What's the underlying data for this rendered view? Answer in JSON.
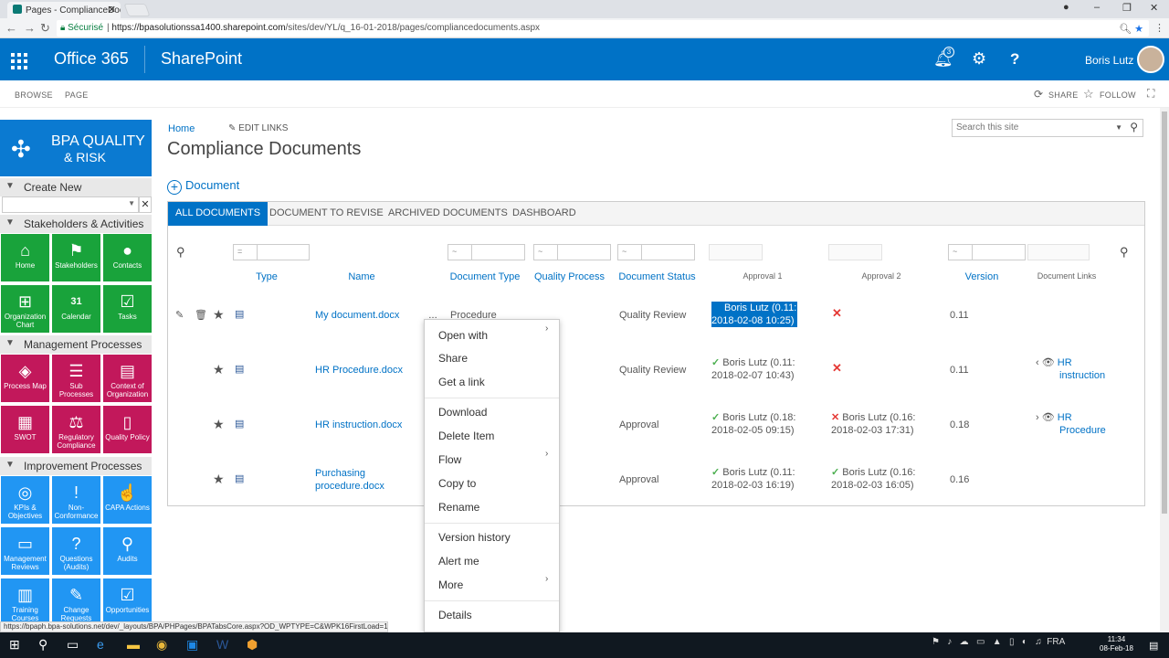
{
  "browser": {
    "tab_title": "Pages - ComplianceDocu",
    "security": "Sécurisé",
    "url_domain": "https://bpasolutionssa1400.sharepoint.com",
    "url_path": "/sites/dev/YL/q_16-01-2018/pages/compliancedocuments.aspx"
  },
  "suite": {
    "product": "Office 365",
    "app": "SharePoint",
    "notif_count": "3",
    "user": "Boris Lutz"
  },
  "ribbon": {
    "browse": "BROWSE",
    "page": "PAGE",
    "share": "SHARE",
    "follow": "FOLLOW"
  },
  "sidebar": {
    "logo_line1": "BPA QUALITY",
    "logo_line2": "& RISK",
    "sections": [
      "Create New",
      "Stakeholders & Activities",
      "Management Processes",
      "Improvement Processes"
    ],
    "tiles": [
      [
        "Home",
        "Stakeholders",
        "Contacts"
      ],
      [
        "Organization Chart",
        "Calendar",
        "Tasks"
      ],
      [
        "Process Map",
        "Sub Processes",
        "Context of Organization"
      ],
      [
        "SWOT",
        "Regulatory Compliance",
        "Quality Policy"
      ],
      [
        "KPIs & Objectives",
        "Non-Conformance",
        "CAPA Actions"
      ],
      [
        "Management Reviews",
        "Questions (Audits)",
        "Audits"
      ],
      [
        "Training Courses",
        "Change Requests",
        "Opportunities"
      ]
    ],
    "calendar_day": "31"
  },
  "main": {
    "crumb": "Home",
    "edit_links": "EDIT LINKS",
    "title": "Compliance Documents",
    "new_doc": "Document",
    "search_placeholder": "Search this site",
    "tabs": [
      "ALL DOCUMENTS",
      "DOCUMENT TO REVISE",
      "ARCHIVED DOCUMENTS",
      "DASHBOARD"
    ],
    "filter_ops": [
      "=",
      "~",
      "~",
      "~",
      "~"
    ],
    "columns": [
      "Type",
      "Name",
      "Document Type",
      "Quality Process",
      "Document Status",
      "Approval 1",
      "Approval 2",
      "Version",
      "Document Links"
    ],
    "rows": [
      {
        "name": "My document.docx",
        "doc_type": "Procedure",
        "status": "Quality Review",
        "a1": "Boris Lutz (0.11:",
        "a1b": "2018-02-08 10:25)",
        "a2": "",
        "a2b": "",
        "version": "0.11",
        "link": "",
        "linkb": ""
      },
      {
        "name": "HR Procedure.docx",
        "doc_type": "",
        "status": "Quality Review",
        "a1": "Boris Lutz (0.11:",
        "a1b": "2018-02-07 10:43)",
        "a2": "",
        "a2b": "",
        "version": "0.11",
        "link": "HR",
        "linkb": "instruction"
      },
      {
        "name": "HR instruction.docx",
        "doc_type": "",
        "status": "Approval",
        "a1": "Boris Lutz (0.18:",
        "a1b": "2018-02-05 09:15)",
        "a2": "Boris Lutz (0.16:",
        "a2b": "2018-02-03 17:31)",
        "version": "0.18",
        "link": "HR",
        "linkb": "Procedure"
      },
      {
        "name": "Purchasing",
        "name2": "procedure.docx",
        "doc_type": "",
        "status": "Approval",
        "a1": "Boris Lutz (0.11:",
        "a1b": "2018-02-03 16:19)",
        "a2": "Boris Lutz (0.16:",
        "a2b": "2018-02-03 16:05)",
        "version": "0.16",
        "link": "",
        "linkb": ""
      }
    ]
  },
  "menu": [
    "Open with",
    "Share",
    "Get a link",
    "Download",
    "Delete Item",
    "Flow",
    "Copy to",
    "Rename",
    "Version history",
    "Alert me",
    "More",
    "Details"
  ],
  "status_url": "https://bpaph.bpa-solutions.net/dev/_layouts/BPA/PHPages/BPATabsCore.aspx?OD_WPTYPE=C&WPK16FirstLoad=1&...",
  "taskbar": {
    "lang": "FRA",
    "time": "11:34",
    "date": "08-Feb-18"
  },
  "colors": {
    "suite": "#0072c6",
    "green_tile": "#19a33b",
    "red_tile": "#c2185b",
    "blue_tile": "#2196f3"
  }
}
